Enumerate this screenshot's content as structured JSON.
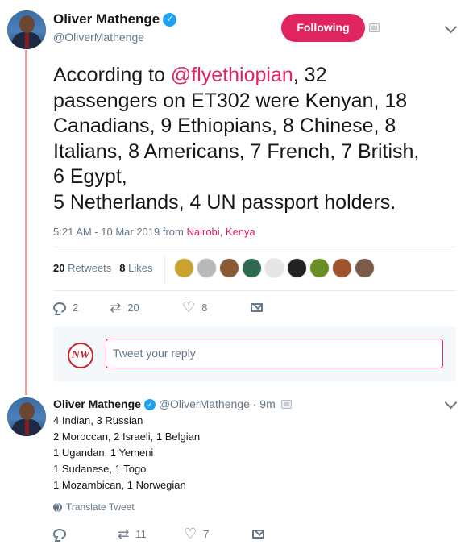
{
  "tweet": {
    "author_name": "Oliver Mathenge",
    "author_handle": "@OliverMathenge",
    "follow_label": "Following",
    "text_lines": [
      [
        "According to ",
        "@flyethiopian",
        ", 32"
      ],
      "passengers on ET302 were Kenyan, 18",
      "Canadians, 9 Ethiopians, 8 Chinese, 8",
      "Italians, 8 Americans, 7 French, 7 British,",
      "6 Egypt,",
      "5 Netherlands, 4 UN passport holders."
    ],
    "timestamp": "5:21 AM - 10 Mar 2019 from",
    "location": "Nairobi, Kenya",
    "retweets_count": "20",
    "retweets_label": "Retweets",
    "likes_count": "8",
    "likes_label": "Likes",
    "liker_colors": [
      "#c9a32e",
      "#b9b9b9",
      "#8a5a34",
      "#2d6a4f",
      "#e6e6e6",
      "#222222",
      "#6b8e23",
      "#a0522d",
      "#7a5c48"
    ],
    "actions": {
      "replies": "2",
      "retweets": "20",
      "likes": "8"
    }
  },
  "reply_composer": {
    "logo_text": "NW",
    "placeholder": "Tweet your reply"
  },
  "reply": {
    "author_name": "Oliver Mathenge",
    "author_handle": "@OliverMathenge",
    "time": "· 9m",
    "lines": [
      "4 Indian, 3 Russian",
      "2 Moroccan, 2 Israeli, 1 Belgian",
      "1 Ugandan, 1 Yemeni",
      "1 Sudanese, 1 Togo",
      "1 Mozambican, 1 Norwegian"
    ],
    "translate_label": "Translate Tweet",
    "actions": {
      "replies": "",
      "retweets": "11",
      "likes": "7"
    }
  },
  "colors": {
    "accent": "#e0245e",
    "verified": "#1da1f2",
    "muted": "#657786"
  },
  "icons": [
    "verified-badge-icon",
    "chevron-down-icon",
    "reply-icon",
    "retweet-icon",
    "heart-icon",
    "message-icon",
    "globe-icon"
  ]
}
